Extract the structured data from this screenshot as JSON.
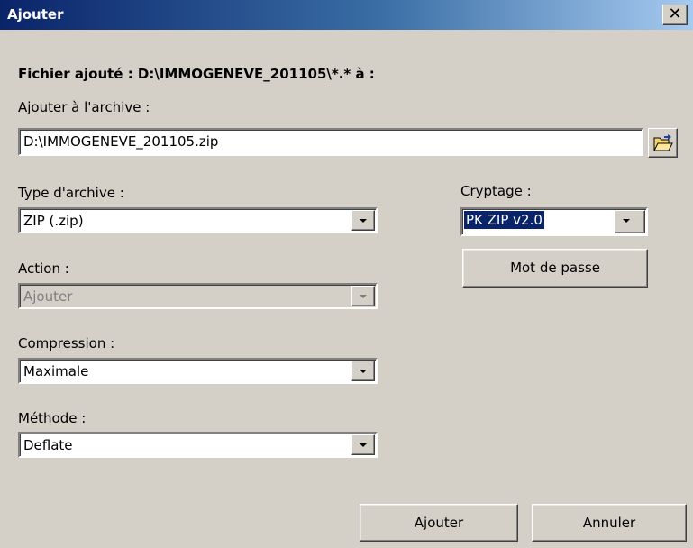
{
  "window": {
    "title": "Ajouter",
    "close_symbol": "✕"
  },
  "header": {
    "file_added": "Fichier ajouté : D:\\IMMOGENEVE_201105\\*.* à :"
  },
  "archive": {
    "label": "Ajouter à l'archive :",
    "value": "D:\\IMMOGENEVE_201105.zip",
    "browse_icon": "open-folder-icon"
  },
  "type": {
    "label": "Type d'archive :",
    "value": "ZIP (.zip)"
  },
  "action": {
    "label": "Action :",
    "value": "Ajouter"
  },
  "compression": {
    "label": "Compression :",
    "value": "Maximale"
  },
  "method": {
    "label": "Méthode :",
    "value": "Deflate"
  },
  "encryption": {
    "label": "Cryptage :",
    "value": "PK ZIP v2.0"
  },
  "buttons": {
    "password": "Mot de passe",
    "add": "Ajouter",
    "cancel": "Annuler"
  },
  "colors": {
    "titlebar_start": "#0a246a",
    "titlebar_end": "#a6caf0",
    "face": "#d4d0c8",
    "selection": "#0a246a"
  }
}
